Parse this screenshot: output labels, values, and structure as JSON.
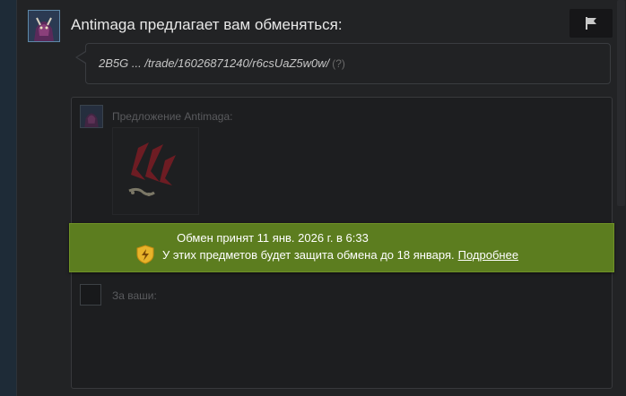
{
  "header": {
    "title": "Antimaga предлагает вам обменяться:",
    "flag_icon": "flag-icon"
  },
  "message": {
    "text": "2B5G ... /trade/16026871240/r6csUaZ5w0w/",
    "help": "(?)"
  },
  "offer": {
    "label": "Предложение Antimaga:",
    "items": [
      {
        "icon": "red-emblem-item-icon"
      }
    ]
  },
  "banner": {
    "line1": "Обмен принят 11 янв. 2026 г. в 6:33",
    "line2": "У этих предметов будет защита обмена до 18 января.",
    "link": "Подробнее",
    "shield_icon": "trade-protection-shield-icon",
    "color": "#5c7d1f"
  },
  "yours": {
    "label": "За ваши:"
  },
  "colors": {
    "background": "#222325",
    "accent": "#5c7d1f"
  }
}
